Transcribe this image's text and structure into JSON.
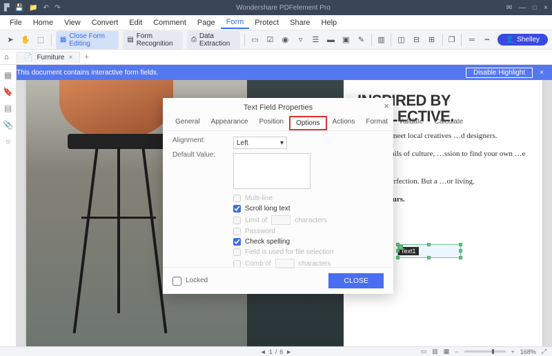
{
  "app": {
    "title": "Wondershare PDFelement Pro"
  },
  "window_controls": {
    "min": "—",
    "max": "□",
    "close": "×",
    "mail": "✉"
  },
  "quick_access": [
    "logo",
    "save",
    "folder",
    "undo",
    "redo"
  ],
  "menu": [
    "File",
    "Home",
    "View",
    "Convert",
    "Edit",
    "Comment",
    "Page",
    "Form",
    "Protect",
    "Share",
    "Help"
  ],
  "menu_active": "Form",
  "toolbar": {
    "close_form_editing": "Close Form Editing",
    "form_recognition": "Form Recognition",
    "data_extraction": "Data Extraction",
    "user": "Shelley"
  },
  "tab": {
    "name": "Furniture"
  },
  "infobar": {
    "message": "This document contains interactive form fields.",
    "disable": "Disable Highlight"
  },
  "document": {
    "heading": "INSPIRED BY COLLECTIVE.",
    "p1": "…dinavia, meet local creatives …d designers.",
    "p2": "…y the details of culture, …ssion to find your own …e expression.",
    "p3": "…uilt on perfection. But a …or living.",
    "p4": "…me to yours.",
    "field_label": "Text1"
  },
  "dialog": {
    "title": "Text Field Properties",
    "tabs": [
      "General",
      "Appearance",
      "Position",
      "Options",
      "Actions",
      "Format",
      "Validate",
      "Calculate"
    ],
    "active_tab": "Options",
    "labels": {
      "alignment": "Alignment:",
      "default_value": "Default Value:"
    },
    "alignment_value": "Left",
    "options": {
      "multi_line": "Multi-line",
      "scroll_long_text": "Scroll long text",
      "limit_of": "Limit of",
      "characters": "characters",
      "password": "Password",
      "check_spelling": "Check spelling",
      "file_selection": "Field is used for file selection",
      "comb_of": "Comb of"
    },
    "checked": {
      "scroll_long_text": true,
      "check_spelling": true
    },
    "locked": "Locked",
    "close": "CLOSE"
  },
  "status": {
    "page": "1",
    "sep": "/",
    "total": "6",
    "zoom": "168%"
  }
}
